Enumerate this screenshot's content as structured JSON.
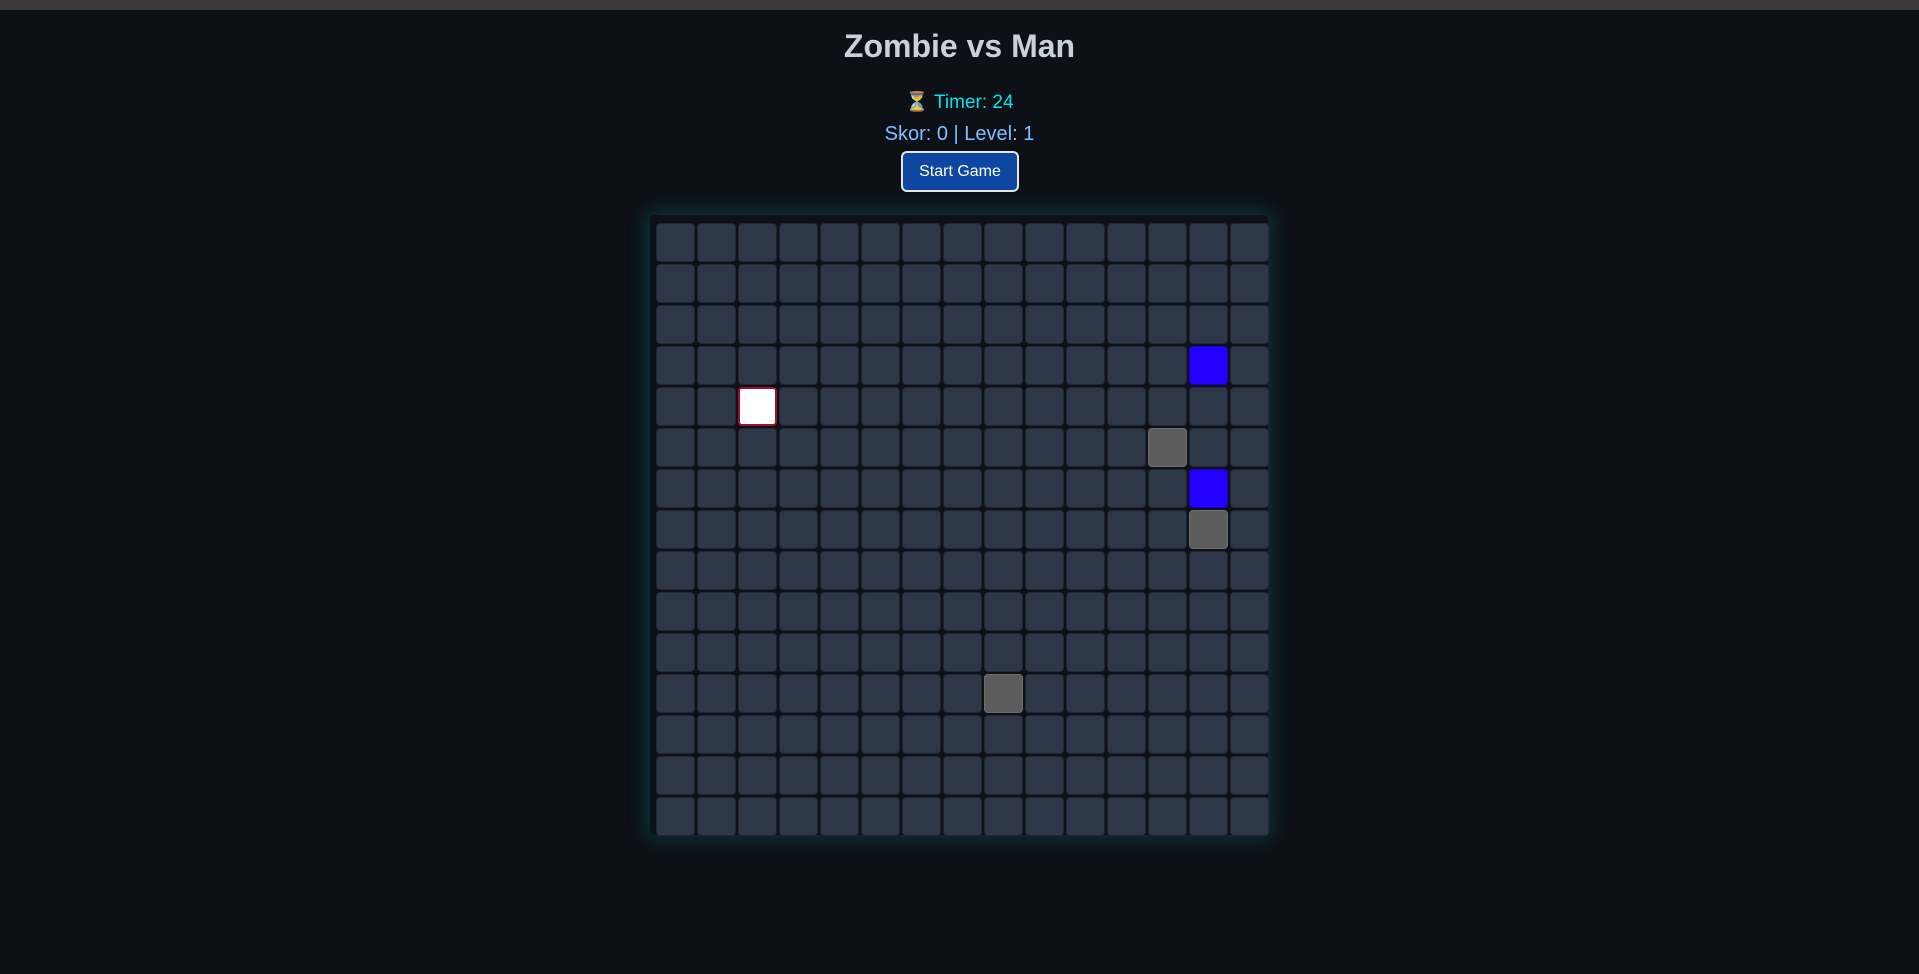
{
  "title": "Zombie vs Man",
  "timer": {
    "icon": "hourglass-icon",
    "text": "⏳ Timer: 24"
  },
  "status": {
    "text": "Skor: 0 | Level: 1"
  },
  "controls": {
    "start_label": "Start Game"
  },
  "board": {
    "rows": 15,
    "cols": 15,
    "player": {
      "row": 4,
      "col": 2
    },
    "zombies": [
      {
        "row": 3,
        "col": 13
      },
      {
        "row": 6,
        "col": 13
      }
    ],
    "obstacles": [
      {
        "row": 5,
        "col": 12
      },
      {
        "row": 7,
        "col": 13
      },
      {
        "row": 11,
        "col": 8
      }
    ]
  },
  "colors": {
    "background": "#0d1117",
    "cell": "#2d3748",
    "player": "#ffffff",
    "zombie": "#2200ff",
    "obstacle": "#5c5c5c",
    "button": "#0d47a1"
  }
}
